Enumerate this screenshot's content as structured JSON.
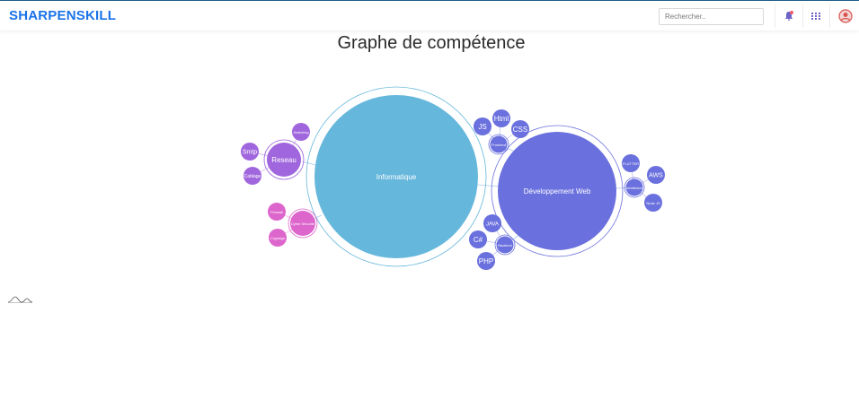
{
  "header": {
    "brand": "SHARPENSKILL",
    "search_placeholder": "Rechercher..",
    "icons": [
      "bell-icon",
      "apps-grid-icon",
      "user-avatar-icon"
    ],
    "brand_color": "#1a73e8"
  },
  "main": {
    "title": "Graphe de compétence"
  },
  "skill_graph": {
    "colors": {
      "informatique": "#66b7dc",
      "web": "#6a70dd",
      "reseau": "#a066dd",
      "security": "#dd66cc"
    },
    "nodes": {
      "informatique": "Informatique",
      "dev_web": "Développement Web",
      "reseau": "Reseau",
      "reseau_children": [
        "Smtp",
        "Cablage",
        "Switching"
      ],
      "cyber_securite": "Cyber Sécurité",
      "cyber_children": [
        "Firewall",
        "Cryptage"
      ],
      "frontend": "Frontend",
      "frontend_children": [
        "JS",
        "Html",
        "CSS"
      ],
      "backend": "Backend",
      "backend_children": [
        "JAVA",
        "C#",
        "PHP"
      ],
      "architecture": "Architecture",
      "architecture_children": [
        "FLUTTER",
        "AWS",
        "Node JS"
      ]
    }
  }
}
